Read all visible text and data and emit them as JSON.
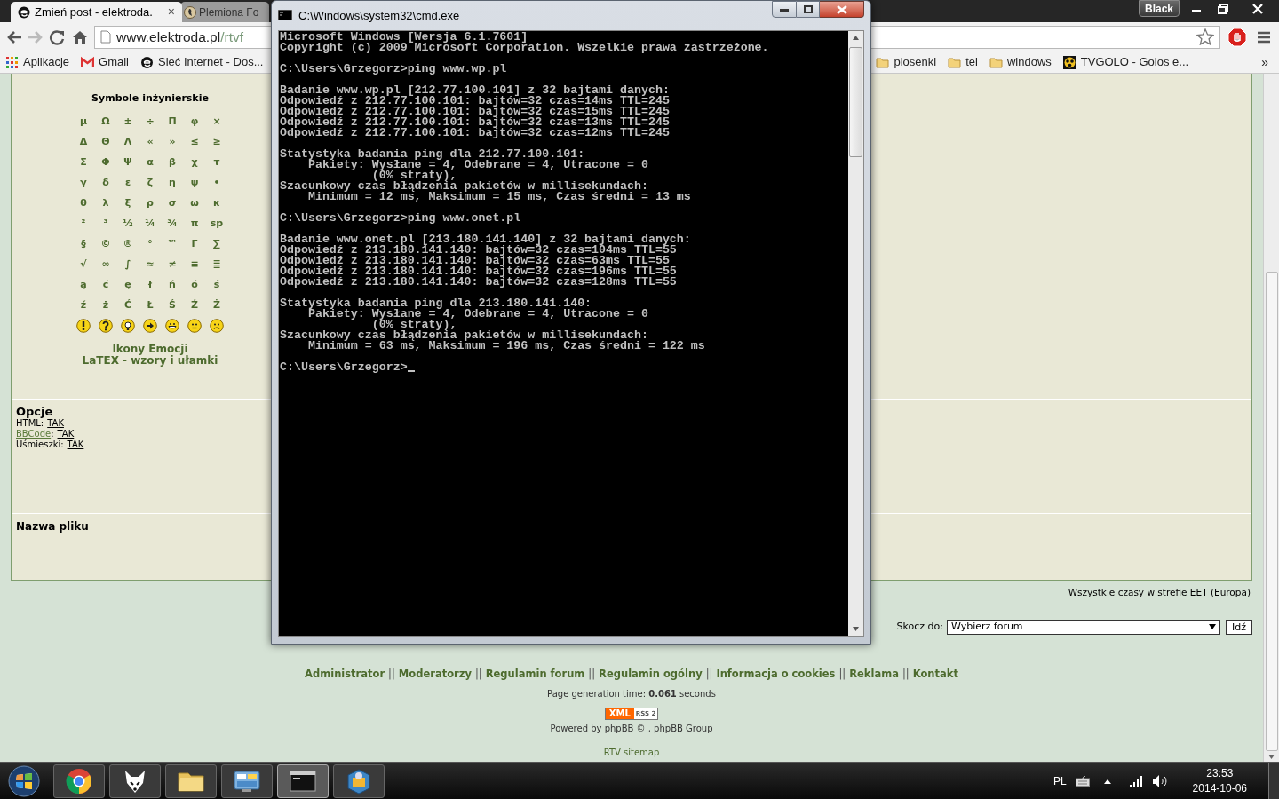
{
  "browser": {
    "tabs": [
      {
        "title": "Zmień post - elektroda.",
        "selected": true,
        "close": "×",
        "kind": "site"
      },
      {
        "title": "Plemiona Fo",
        "selected": false,
        "kind": "bird"
      }
    ],
    "profile_badge": "Black",
    "address": {
      "host": "www.elektroda.pl",
      "path": "/rtvf"
    },
    "bookmarks": [
      {
        "label": "Aplikacje",
        "kind": "apps"
      },
      {
        "label": "Gmail",
        "kind": "gmail"
      },
      {
        "label": "Sieć Internet - Dos...",
        "kind": "site"
      },
      {
        "label": "piosenki",
        "kind": "folder"
      },
      {
        "label": "tel",
        "kind": "folder"
      },
      {
        "label": "windows",
        "kind": "folder"
      },
      {
        "label": "TVGOLO - Golos e...",
        "kind": "ball"
      }
    ],
    "bookmarks_more": "»"
  },
  "page": {
    "symbols": {
      "title": "Symbole inżynierskie",
      "rows": [
        [
          "μ",
          "Ω",
          "±",
          "÷",
          "Π",
          "φ",
          "×"
        ],
        [
          "Δ",
          "Θ",
          "Λ",
          "«",
          "»",
          "≤",
          "≥"
        ],
        [
          "Σ",
          "Φ",
          "Ψ",
          "α",
          "β",
          "χ",
          "τ"
        ],
        [
          "γ",
          "δ",
          "ε",
          "ζ",
          "η",
          "ψ",
          "•"
        ],
        [
          "θ",
          "λ",
          "ξ",
          "ρ",
          "σ",
          "ω",
          "κ"
        ],
        [
          "²",
          "³",
          "½",
          "¼",
          "¾",
          "π",
          "sp"
        ],
        [
          "§",
          "©",
          "®",
          "°",
          "™",
          "Γ",
          "∑"
        ],
        [
          "√",
          "∞",
          "∫",
          "≈",
          "≠",
          "≡",
          "≣"
        ],
        [
          "ą",
          "ć",
          "ę",
          "ł",
          "ń",
          "ó",
          "ś"
        ],
        [
          "ź",
          "ż",
          "Ć",
          "Ł",
          "Ś",
          "Ź",
          "Ż"
        ]
      ],
      "emoticons": [
        {
          "kind": "exclamation"
        },
        {
          "kind": "question"
        },
        {
          "kind": "idea"
        },
        {
          "kind": "arrow"
        },
        {
          "kind": "grin"
        },
        {
          "kind": "neutral"
        },
        {
          "kind": "sad"
        }
      ],
      "links": [
        "Ikony Emocji",
        "LaTEX - wzory i ułamki"
      ]
    },
    "options": {
      "title": "Opcje",
      "items": [
        {
          "label": "HTML",
          "colon": ":",
          "value": "TAK",
          "label_is_link": false
        },
        {
          "label": "BBCode",
          "colon": ":",
          "value": "TAK",
          "label_is_link": true
        },
        {
          "label": "Uśmieszki",
          "colon": ":",
          "value": "TAK",
          "label_is_link": false
        }
      ]
    },
    "file_label": "Nazwa pliku",
    "timezone": "Wszystkie czasy w strefie EET (Europa)",
    "jump": {
      "label": "Skocz do:",
      "value": "Wybierz forum",
      "button": "Idź"
    },
    "footer_links": [
      {
        "kind": "link",
        "text": "Administrator"
      },
      {
        "kind": "separator",
        "text": "||"
      },
      {
        "kind": "link",
        "text": "Moderatorzy"
      },
      {
        "kind": "separator",
        "text": "||"
      },
      {
        "kind": "link",
        "text": "Regulamin forum"
      },
      {
        "kind": "separator",
        "text": "||"
      },
      {
        "kind": "link",
        "text": "Regulamin ogólny"
      },
      {
        "kind": "separator",
        "text": "||"
      },
      {
        "kind": "link",
        "text": "Informacja o cookies"
      },
      {
        "kind": "separator",
        "text": "||"
      },
      {
        "kind": "link",
        "text": "Reklama"
      },
      {
        "kind": "separator",
        "text": "||"
      },
      {
        "kind": "link",
        "text": "Kontakt"
      }
    ],
    "generation_time": "Page generation time: **0.061** seconds",
    "rss_badge": {
      "left": "XML",
      "right": "RSS 2"
    },
    "powered_by": "Powered by phpBB © , phpBB Group",
    "sitemap": "RTV sitemap"
  },
  "console": {
    "title": "C:\\Windows\\system32\\cmd.exe",
    "cursor": true,
    "blocks": [
      [
        "Microsoft Windows [Wersja 6.1.7601]",
        "Copyright (c) 2009 Microsoft Corporation. Wszelkie prawa zastrzeżone."
      ],
      [
        "C:\\Users\\Grzegorz>ping www.wp.pl"
      ],
      [
        "Badanie www.wp.pl [212.77.100.101] z 32 bajtami danych:",
        "Odpowiedź z 212.77.100.101: bajtów=32 czas=14ms TTL=245",
        "Odpowiedź z 212.77.100.101: bajtów=32 czas=15ms TTL=245",
        "Odpowiedź z 212.77.100.101: bajtów=32 czas=13ms TTL=245",
        "Odpowiedź z 212.77.100.101: bajtów=32 czas=12ms TTL=245"
      ],
      [
        "Statystyka badania ping dla 212.77.100.101:",
        "    Pakiety: Wysłane = 4, Odebrane = 4, Utracone = 0",
        "             (0% straty),",
        "Szacunkowy czas błądzenia pakietów w millisekundach:",
        "    Minimum = 12 ms, Maksimum = 15 ms, Czas średni = 13 ms"
      ],
      [
        "C:\\Users\\Grzegorz>ping www.onet.pl"
      ],
      [
        "Badanie www.onet.pl [213.180.141.140] z 32 bajtami danych:",
        "Odpowiedź z 213.180.141.140: bajtów=32 czas=104ms TTL=55",
        "Odpowiedź z 213.180.141.140: bajtów=32 czas=63ms TTL=55",
        "Odpowiedź z 213.180.141.140: bajtów=32 czas=196ms TTL=55",
        "Odpowiedź z 213.180.141.140: bajtów=32 czas=128ms TTL=55"
      ],
      [
        "Statystyka badania ping dla 213.180.141.140:",
        "    Pakiety: Wysłane = 4, Odebrane = 4, Utracone = 0",
        "             (0% straty),",
        "Szacunkowy czas błądzenia pakietów w millisekundach:",
        "    Minimum = 63 ms, Maksimum = 196 ms, Czas średni = 122 ms"
      ],
      [
        "C:\\Users\\Grzegorz>"
      ]
    ]
  },
  "taskbar": {
    "buttons": [
      {
        "kind": "browser",
        "selected": false
      },
      {
        "kind": "fox",
        "selected": false
      },
      {
        "kind": "folder",
        "selected": false
      },
      {
        "kind": "control-panel",
        "selected": false
      },
      {
        "kind": "console",
        "selected": true
      },
      {
        "kind": "blue-app",
        "selected": false
      }
    ],
    "language": "PL",
    "time": "23:53",
    "date": "2014-10-06"
  }
}
